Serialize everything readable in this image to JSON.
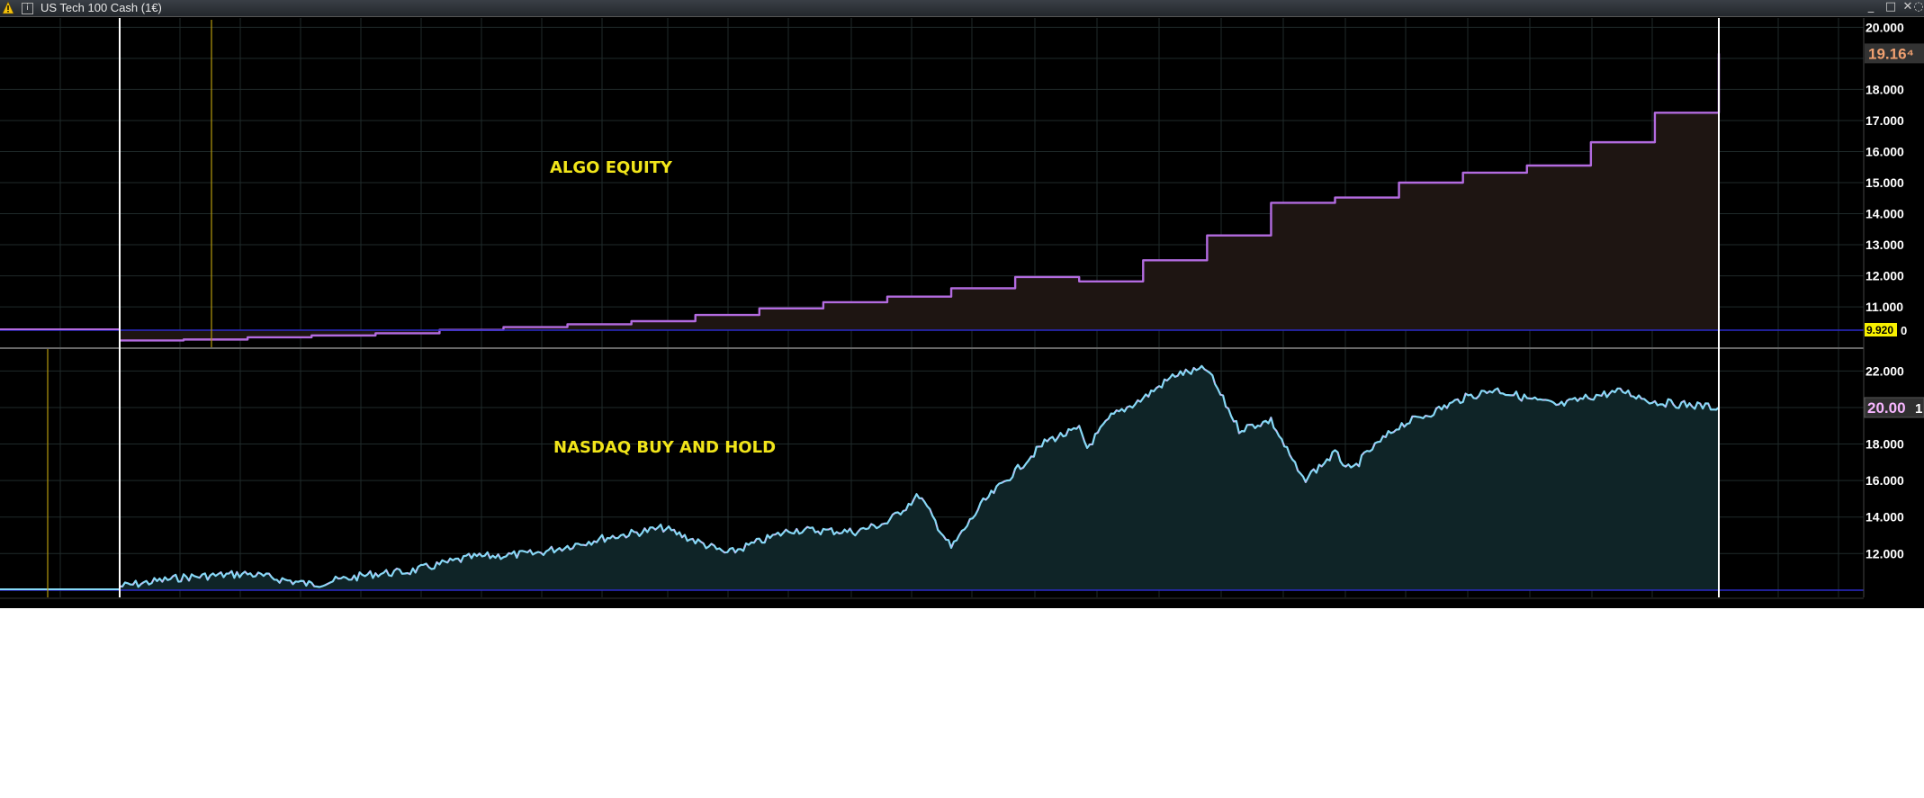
{
  "titlebar": {
    "title": "US Tech 100 Cash (1€)",
    "warning_icon": "warning-icon",
    "info_icon": "info-icon",
    "info_glyph": "i",
    "minimize_glyph": "_",
    "maximize_glyph": "□",
    "close_glyph": "✕",
    "extra_glyph": "◌"
  },
  "labels": {
    "top": "ALGO EQUITY",
    "bottom": "NASDAQ BUY AND HOLD"
  },
  "colors": {
    "background": "#000000",
    "grid": "#1f2a2a",
    "algo_line": "#b36be0",
    "algo_fill": "#1e1512",
    "nasdaq_line": "#86d8f6",
    "nasdaq_line_alt": "#e8a6ef",
    "nasdaq_fill": "#0f2427",
    "baseline": "#2b2bc9",
    "cursor": "#ffffff",
    "vmarker": "#b59a0d",
    "label": "#f1e51a",
    "badge_last_algo_bg": "#333333",
    "badge_last_algo_fg": "#f0a070",
    "badge_base_bg": "#f7f000",
    "badge_last_nasdaq_bg": "#303030",
    "badge_last_nasdaq_fg": "#f7b6ff"
  },
  "chart_data": [
    {
      "type": "line",
      "series": [
        {
          "name": "ALGO EQUITY",
          "x": [
            0,
            4,
            8,
            12,
            16,
            20,
            24,
            28,
            32,
            36,
            40,
            44,
            48,
            52,
            56,
            60,
            64,
            68,
            72,
            76,
            80,
            84,
            88,
            92,
            96,
            100
          ],
          "values": [
            9920,
            9950,
            10020,
            10080,
            10150,
            10260,
            10350,
            10440,
            10540,
            10740,
            10950,
            11150,
            11330,
            11600,
            11960,
            11820,
            12500,
            13300,
            14350,
            14520,
            15000,
            15320,
            15550,
            16300,
            17250,
            19160
          ]
        }
      ],
      "yticks": [
        "11.000",
        "12.000",
        "13.000",
        "14.000",
        "15.000",
        "16.000",
        "17.000",
        "18.000",
        "19.000",
        "20.000"
      ],
      "ylim": [
        9700,
        20300
      ],
      "grid": true,
      "last_value_label": "19.16⁴",
      "base_value_label": "9.920",
      "base_value_suffix": "0"
    },
    {
      "type": "area",
      "series": [
        {
          "name": "NASDAQ BUY AND HOLD",
          "x": [
            0,
            4,
            8,
            12,
            16,
            18,
            22,
            26,
            30,
            34,
            38,
            42,
            46,
            48,
            50,
            52,
            54,
            56,
            58,
            60,
            60.5,
            62,
            64,
            66,
            68,
            70,
            72,
            74,
            76,
            77,
            78,
            80,
            82,
            84,
            86,
            88,
            90,
            92,
            94,
            96,
            100
          ],
          "values": [
            10200,
            10700,
            10900,
            10300,
            10900,
            11000,
            11800,
            12000,
            12800,
            13400,
            12000,
            13300,
            13200,
            13700,
            15200,
            12300,
            14800,
            16500,
            18200,
            18800,
            17800,
            19500,
            20500,
            21800,
            22100,
            18800,
            19300,
            16000,
            17500,
            16500,
            17500,
            19000,
            19700,
            20500,
            21000,
            20500,
            20100,
            20600,
            20900,
            20300,
            20000
          ]
        }
      ],
      "yticks": [
        "12.000",
        "14.000",
        "16.000",
        "18.000",
        "20.000",
        "22.000"
      ],
      "ylim": [
        9600,
        23200
      ],
      "grid": true,
      "last_value_label": "20.00",
      "last_value_suffix": "1"
    }
  ]
}
